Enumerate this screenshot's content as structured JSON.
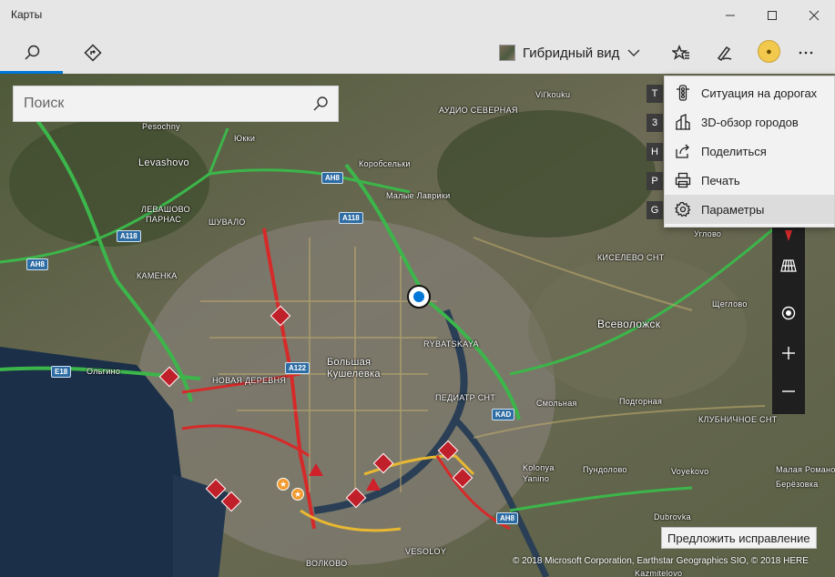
{
  "window": {
    "title": "Карты",
    "minimize": "minimize",
    "maximize": "maximize",
    "close": "close"
  },
  "toolbar": {
    "view_mode_label": "Гибридный вид",
    "icons": [
      "search-icon",
      "directions-icon",
      "favorites-icon",
      "ink-pen-icon",
      "avatar",
      "more-icon"
    ]
  },
  "search": {
    "placeholder": "Поиск"
  },
  "menu": {
    "items": [
      {
        "label": "Ситуация на дорогах",
        "icon": "traffic-light-icon"
      },
      {
        "label": "3D-обзор городов",
        "icon": "city-3d-icon"
      },
      {
        "label": "Поделиться",
        "icon": "share-icon"
      },
      {
        "label": "Печать",
        "icon": "print-icon"
      },
      {
        "label": "Параметры",
        "icon": "gear-icon"
      }
    ],
    "peek_letters": [
      "T",
      "3",
      "H",
      "P",
      "G"
    ]
  },
  "map_controls": [
    "compass-icon",
    "tilt-icon",
    "my-location-icon",
    "zoom-in-icon",
    "zoom-out-icon"
  ],
  "map": {
    "places": [
      "Pesochny",
      "Юкки",
      "Levashovo",
      "Коробсельки",
      "Малые Лаврики",
      "Vil'kouku",
      "ЛЕВАШОВО",
      "ПАРНАС",
      "ШУВАЛО",
      "КАМЕНКА",
      "Ольгино",
      "НОВАЯ ДЕРЕВНЯ",
      "Большая Кушелевка",
      "RYBATSKAYA",
      "ПЕДИАТР СНТ",
      "Всеволожск",
      "Щеглово",
      "КИСЕЛЕВО СНТ",
      "Углово",
      "Смольная",
      "Подгорная",
      "КЛУБНИЧНОЕ СНТ",
      "Kolonya Yanino",
      "Пундолово",
      "Voyekovo",
      "Малая Романовка",
      "Берёзовка",
      "Dubrovka",
      "VESOLOY",
      "ВОЛКОВО",
      "Kazmitelovo",
      "АУДИО СЕВЕРНАЯ"
    ],
    "road_shields": [
      "A118",
      "AH8",
      "A118",
      "AH8",
      "A122",
      "E18",
      "KAD",
      "AH8"
    ]
  },
  "suggest_label": "Предложить исправление",
  "copyright": "© 2018 Microsoft Corporation, Earthstar Geographics SIO, © 2018 HERE",
  "colors": {
    "accent": "#0078d7",
    "traffic_green": "#3cb64a",
    "traffic_red": "#d62a2a",
    "traffic_yellow": "#e8b832"
  }
}
